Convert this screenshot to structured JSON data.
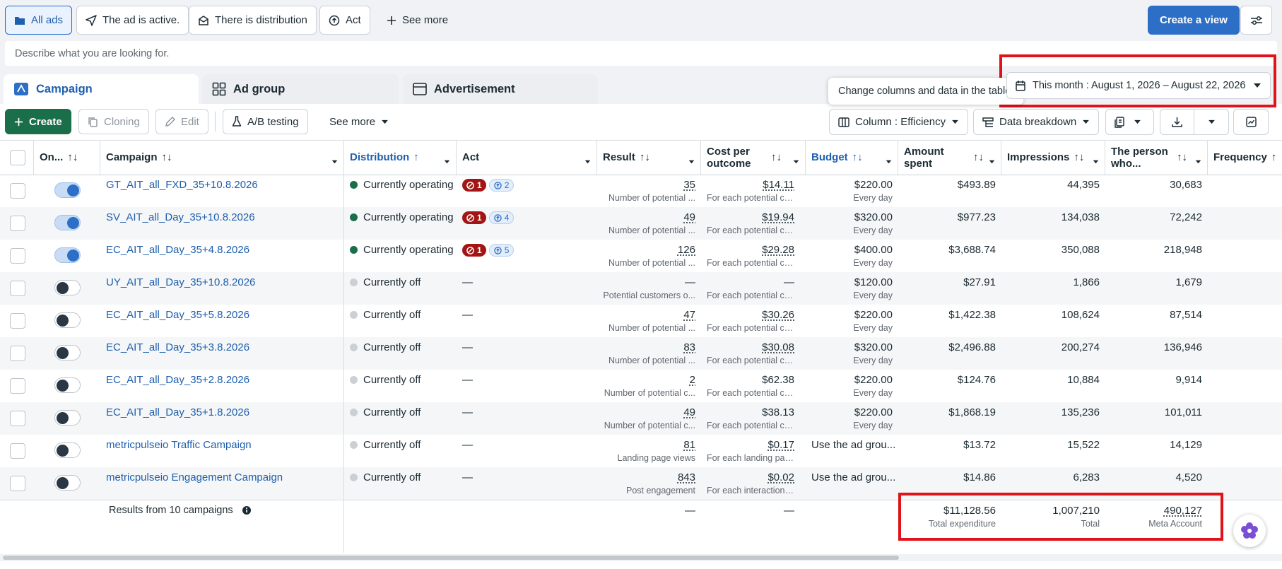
{
  "filters": {
    "all_ads": "All ads",
    "ad_active": "The ad is active.",
    "distribution": "There is distribution",
    "act": "Act",
    "see_more": "See more",
    "create_view": "Create a view"
  },
  "search": {
    "placeholder": "Describe what you are looking for."
  },
  "level_tabs": {
    "campaign": "Campaign",
    "ad_group": "Ad group",
    "advertisement": "Advertisement"
  },
  "tooltip": "Change columns and data in the table.",
  "date_range": "This month : August 1, 2026 – August 22, 2026",
  "toolbar": {
    "create": "Create",
    "cloning": "Cloning",
    "edit": "Edit",
    "ab_testing": "A/B testing",
    "see_more": "See more",
    "columns": "Column : Efficiency",
    "breakdown": "Data breakdown"
  },
  "headers": {
    "on_off": "On...",
    "campaign": "Campaign",
    "distribution": "Distribution",
    "act": "Act",
    "result": "Result",
    "cost_per_outcome": "Cost per outcome",
    "budget": "Budget",
    "amount_spent": "Amount spent",
    "impressions": "Impressions",
    "reach": "The person who...",
    "frequency": "Frequency"
  },
  "rows": [
    {
      "name": "GT_AIT_all_FXD_35+10.8.2026",
      "on": true,
      "status": "Currently operating",
      "act_red": "1",
      "act_blue": "2",
      "result": "35",
      "result_sub": "Number of potential ...",
      "cost": "$14.11",
      "cost_sub": "For each potential cu...",
      "budget": "$220.00",
      "budget_sub": "Every day",
      "spent": "$493.89",
      "impressions": "44,395",
      "reach": "30,683"
    },
    {
      "name": "SV_AIT_all_Day_35+10.8.2026",
      "on": true,
      "status": "Currently operating",
      "act_red": "1",
      "act_blue": "4",
      "result": "49",
      "result_sub": "Number of potential ...",
      "cost": "$19.94",
      "cost_sub": "For each potential cu...",
      "budget": "$320.00",
      "budget_sub": "Every day",
      "spent": "$977.23",
      "impressions": "134,038",
      "reach": "72,242"
    },
    {
      "name": "EC_AIT_all_Day_35+4.8.2026",
      "on": true,
      "status": "Currently operating",
      "act_red": "1",
      "act_blue": "5",
      "result": "126",
      "result_sub": "Number of potential ...",
      "cost": "$29.28",
      "cost_sub": "For each potential cu...",
      "budget": "$400.00",
      "budget_sub": "Every day",
      "spent": "$3,688.74",
      "impressions": "350,088",
      "reach": "218,948"
    },
    {
      "name": "UY_AIT_all_Day_35+10.8.2026",
      "on": false,
      "status": "Currently off",
      "act": "—",
      "result": "—",
      "result_sub": "Potential customers o...",
      "cost": "—",
      "cost_sub": "For each potential cus...",
      "budget": "$120.00",
      "budget_sub": "Every day",
      "spent": "$27.91",
      "impressions": "1,866",
      "reach": "1,679"
    },
    {
      "name": "EC_AIT_all_Day_35+5.8.2026",
      "on": false,
      "status": "Currently off",
      "act": "—",
      "result": "47",
      "result_sub": "Number of potential ...",
      "cost": "$30.26",
      "cost_sub": "For each potential cu...",
      "budget": "$220.00",
      "budget_sub": "Every day",
      "spent": "$1,422.38",
      "impressions": "108,624",
      "reach": "87,514"
    },
    {
      "name": "EC_AIT_all_Day_35+3.8.2026",
      "on": false,
      "status": "Currently off",
      "act": "—",
      "result": "83",
      "result_sub": "Number of potential ...",
      "cost": "$30.08",
      "cost_sub": "For each potential cu...",
      "budget": "$320.00",
      "budget_sub": "Every day",
      "spent": "$2,496.88",
      "impressions": "200,274",
      "reach": "136,946"
    },
    {
      "name": "EC_AIT_all_Day_35+2.8.2026",
      "on": false,
      "status": "Currently off",
      "act": "—",
      "result": "2",
      "result_sub": "Number of potential c...",
      "cost": "$62.38",
      "cost_sub": "For each potential cus...",
      "budget": "$220.00",
      "budget_sub": "Every day",
      "spent": "$124.76",
      "impressions": "10,884",
      "reach": "9,914"
    },
    {
      "name": "EC_AIT_all_Day_35+1.8.2026",
      "on": false,
      "status": "Currently off",
      "act": "—",
      "result": "49",
      "result_sub": "Number of potential c...",
      "cost": "$38.13",
      "cost_sub": "For each potential cus...",
      "budget": "$220.00",
      "budget_sub": "Every day",
      "spent": "$1,868.19",
      "impressions": "135,236",
      "reach": "101,011"
    },
    {
      "name": "metricpulseio Traffic Campaign",
      "on": false,
      "status": "Currently off",
      "act": "—",
      "result": "81",
      "result_sub": "Landing page views",
      "cost": "$0.17",
      "cost_sub": "For each landing page...",
      "budget": "Use the ad grou...",
      "budget_sub": "",
      "spent": "$13.72",
      "impressions": "15,522",
      "reach": "14,129"
    },
    {
      "name": "metricpulseio Engagement Campaign",
      "on": false,
      "status": "Currently off",
      "act": "—",
      "result": "843",
      "result_sub": "Post engagement",
      "cost": "$0.02",
      "cost_sub": "For each interaction w...",
      "budget": "Use the ad grou...",
      "budget_sub": "",
      "spent": "$14.86",
      "impressions": "6,283",
      "reach": "4,520"
    }
  ],
  "totals": {
    "label": "Results from 10 campaigns",
    "result": "—",
    "cost": "—",
    "spent": "$11,128.56",
    "spent_sub": "Total expenditure",
    "impressions": "1,007,210",
    "impressions_sub": "Total",
    "reach": "490,127",
    "reach_sub": "Meta Account"
  },
  "colors": {
    "accent": "#2d6fc7",
    "active_dot": "#1b6e4a",
    "off_dot": "#ccd0d5",
    "create": "#1b6e4a",
    "alert": "#a31515",
    "highlight": "#e0121a"
  }
}
